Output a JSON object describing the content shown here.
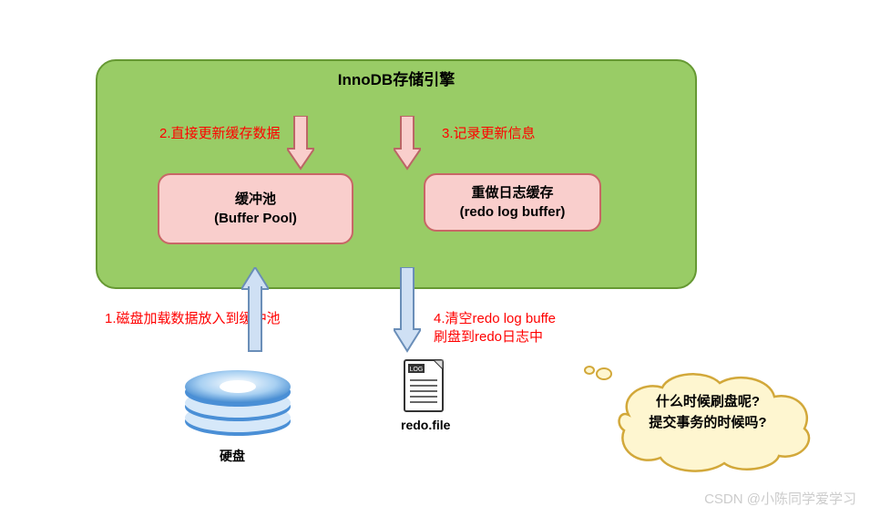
{
  "title": "InnoDB存储引擎",
  "steps": {
    "s1": "1.磁盘加载数据放入到缓冲池",
    "s2": "2.直接更新缓存数据",
    "s3": "3.记录更新信息",
    "s4a": "4.清空redo log buffe",
    "s4b": "刷盘到redo日志中"
  },
  "boxes": {
    "bufferPool": {
      "line1": "缓冲池",
      "line2": "(Buffer Pool)"
    },
    "redoBuffer": {
      "line1": "重做日志缓存",
      "line2": "(redo log buffer)"
    }
  },
  "labels": {
    "disk": "硬盘",
    "redoFile": "redo.file"
  },
  "cloud": {
    "line1": "什么时候刷盘呢?",
    "line2": "提交事务的时候吗?"
  },
  "watermark": "CSDN @小陈同学爱学习"
}
